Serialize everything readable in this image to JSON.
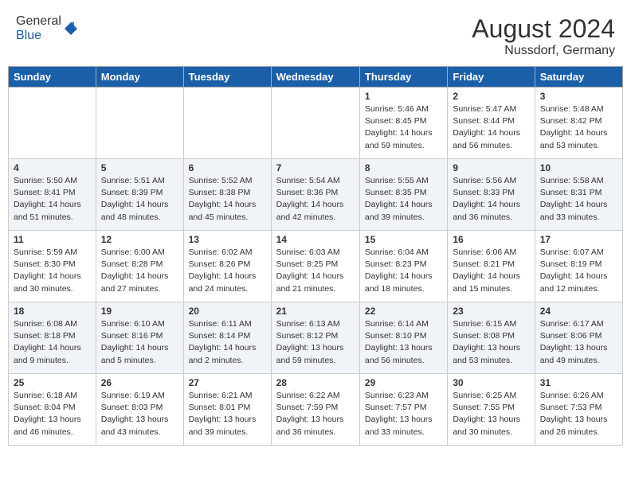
{
  "header": {
    "logo_general": "General",
    "logo_blue": "Blue",
    "main_title": "August 2024",
    "subtitle": "Nussdorf, Germany"
  },
  "calendar": {
    "headers": [
      "Sunday",
      "Monday",
      "Tuesday",
      "Wednesday",
      "Thursday",
      "Friday",
      "Saturday"
    ],
    "weeks": [
      [
        {
          "day": "",
          "info": ""
        },
        {
          "day": "",
          "info": ""
        },
        {
          "day": "",
          "info": ""
        },
        {
          "day": "",
          "info": ""
        },
        {
          "day": "1",
          "info": "Sunrise: 5:46 AM\nSunset: 8:45 PM\nDaylight: 14 hours\nand 59 minutes."
        },
        {
          "day": "2",
          "info": "Sunrise: 5:47 AM\nSunset: 8:44 PM\nDaylight: 14 hours\nand 56 minutes."
        },
        {
          "day": "3",
          "info": "Sunrise: 5:48 AM\nSunset: 8:42 PM\nDaylight: 14 hours\nand 53 minutes."
        }
      ],
      [
        {
          "day": "4",
          "info": "Sunrise: 5:50 AM\nSunset: 8:41 PM\nDaylight: 14 hours\nand 51 minutes."
        },
        {
          "day": "5",
          "info": "Sunrise: 5:51 AM\nSunset: 8:39 PM\nDaylight: 14 hours\nand 48 minutes."
        },
        {
          "day": "6",
          "info": "Sunrise: 5:52 AM\nSunset: 8:38 PM\nDaylight: 14 hours\nand 45 minutes."
        },
        {
          "day": "7",
          "info": "Sunrise: 5:54 AM\nSunset: 8:36 PM\nDaylight: 14 hours\nand 42 minutes."
        },
        {
          "day": "8",
          "info": "Sunrise: 5:55 AM\nSunset: 8:35 PM\nDaylight: 14 hours\nand 39 minutes."
        },
        {
          "day": "9",
          "info": "Sunrise: 5:56 AM\nSunset: 8:33 PM\nDaylight: 14 hours\nand 36 minutes."
        },
        {
          "day": "10",
          "info": "Sunrise: 5:58 AM\nSunset: 8:31 PM\nDaylight: 14 hours\nand 33 minutes."
        }
      ],
      [
        {
          "day": "11",
          "info": "Sunrise: 5:59 AM\nSunset: 8:30 PM\nDaylight: 14 hours\nand 30 minutes."
        },
        {
          "day": "12",
          "info": "Sunrise: 6:00 AM\nSunset: 8:28 PM\nDaylight: 14 hours\nand 27 minutes."
        },
        {
          "day": "13",
          "info": "Sunrise: 6:02 AM\nSunset: 8:26 PM\nDaylight: 14 hours\nand 24 minutes."
        },
        {
          "day": "14",
          "info": "Sunrise: 6:03 AM\nSunset: 8:25 PM\nDaylight: 14 hours\nand 21 minutes."
        },
        {
          "day": "15",
          "info": "Sunrise: 6:04 AM\nSunset: 8:23 PM\nDaylight: 14 hours\nand 18 minutes."
        },
        {
          "day": "16",
          "info": "Sunrise: 6:06 AM\nSunset: 8:21 PM\nDaylight: 14 hours\nand 15 minutes."
        },
        {
          "day": "17",
          "info": "Sunrise: 6:07 AM\nSunset: 8:19 PM\nDaylight: 14 hours\nand 12 minutes."
        }
      ],
      [
        {
          "day": "18",
          "info": "Sunrise: 6:08 AM\nSunset: 8:18 PM\nDaylight: 14 hours\nand 9 minutes."
        },
        {
          "day": "19",
          "info": "Sunrise: 6:10 AM\nSunset: 8:16 PM\nDaylight: 14 hours\nand 5 minutes."
        },
        {
          "day": "20",
          "info": "Sunrise: 6:11 AM\nSunset: 8:14 PM\nDaylight: 14 hours\nand 2 minutes."
        },
        {
          "day": "21",
          "info": "Sunrise: 6:13 AM\nSunset: 8:12 PM\nDaylight: 13 hours\nand 59 minutes."
        },
        {
          "day": "22",
          "info": "Sunrise: 6:14 AM\nSunset: 8:10 PM\nDaylight: 13 hours\nand 56 minutes."
        },
        {
          "day": "23",
          "info": "Sunrise: 6:15 AM\nSunset: 8:08 PM\nDaylight: 13 hours\nand 53 minutes."
        },
        {
          "day": "24",
          "info": "Sunrise: 6:17 AM\nSunset: 8:06 PM\nDaylight: 13 hours\nand 49 minutes."
        }
      ],
      [
        {
          "day": "25",
          "info": "Sunrise: 6:18 AM\nSunset: 8:04 PM\nDaylight: 13 hours\nand 46 minutes."
        },
        {
          "day": "26",
          "info": "Sunrise: 6:19 AM\nSunset: 8:03 PM\nDaylight: 13 hours\nand 43 minutes."
        },
        {
          "day": "27",
          "info": "Sunrise: 6:21 AM\nSunset: 8:01 PM\nDaylight: 13 hours\nand 39 minutes."
        },
        {
          "day": "28",
          "info": "Sunrise: 6:22 AM\nSunset: 7:59 PM\nDaylight: 13 hours\nand 36 minutes."
        },
        {
          "day": "29",
          "info": "Sunrise: 6:23 AM\nSunset: 7:57 PM\nDaylight: 13 hours\nand 33 minutes."
        },
        {
          "day": "30",
          "info": "Sunrise: 6:25 AM\nSunset: 7:55 PM\nDaylight: 13 hours\nand 30 minutes."
        },
        {
          "day": "31",
          "info": "Sunrise: 6:26 AM\nSunset: 7:53 PM\nDaylight: 13 hours\nand 26 minutes."
        }
      ]
    ]
  }
}
